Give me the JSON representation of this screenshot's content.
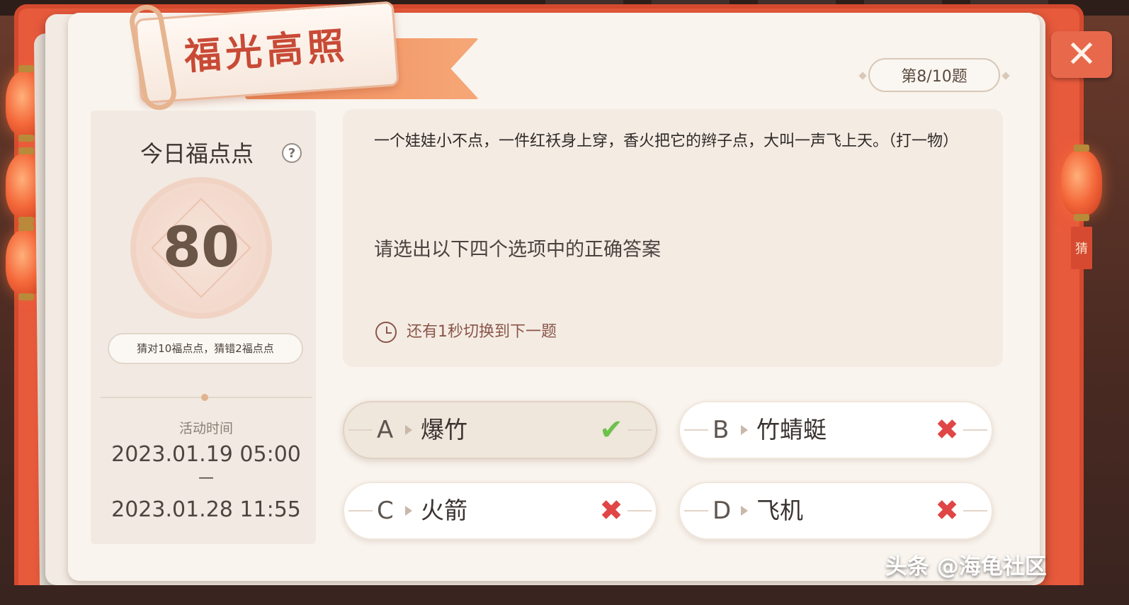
{
  "title": "福光高照",
  "close_label": "✕",
  "side_tag": "猜",
  "counter": "第8/10题",
  "points": {
    "title": "今日福点点",
    "help": "?",
    "value": "80",
    "rule": "猜对10福点点，猜错2福点点"
  },
  "activity": {
    "label": "活动时间",
    "start": "2023.01.19 05:00",
    "dash": "—",
    "end": "2023.01.28 11:55"
  },
  "question": {
    "text": "一个娃娃小不点，一件红袄身上穿，香火把它的辫子点，大叫一声飞上天。（打一物）",
    "instruction": "请选出以下四个选项中的正确答案",
    "timer": "还有1秒切换到下一题"
  },
  "options": [
    {
      "letter": "A",
      "text": "爆竹",
      "mark": "✔",
      "result": "correct"
    },
    {
      "letter": "B",
      "text": "竹蜻蜓",
      "mark": "✖",
      "result": "wrong"
    },
    {
      "letter": "C",
      "text": "火箭",
      "mark": "✖",
      "result": "wrong"
    },
    {
      "letter": "D",
      "text": "飞机",
      "mark": "✖",
      "result": "wrong"
    }
  ],
  "watermark": "头条 @海龟社区",
  "colors": {
    "accent": "#e85a3c",
    "correct": "#6cc24a",
    "wrong": "#e04646"
  }
}
